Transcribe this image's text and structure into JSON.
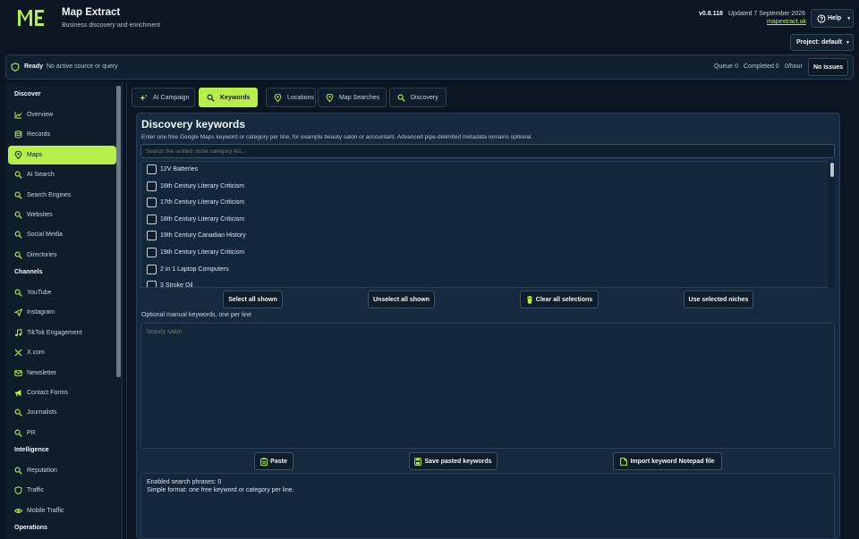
{
  "header": {
    "title": "Map Extract",
    "subtitle": "Business discovery and enrichment",
    "version": "v0.8.118",
    "updated": "Updated 7 September 2026",
    "site_link": "mapextract.uk",
    "help_label": "Help",
    "project_label": "Project: default",
    "accent_color": "#b7ef4a"
  },
  "status": {
    "state": "Ready",
    "message": "No active source or query",
    "queue": "Queue 0",
    "completed": "Completed 0",
    "rate": "0/hour",
    "issues": "No issues"
  },
  "sidebar": {
    "sections": [
      {
        "heading": "Discover",
        "items": [
          {
            "label": "Overview",
            "icon": "chart-line-icon"
          },
          {
            "label": "Records",
            "icon": "database-icon"
          },
          {
            "label": "Maps",
            "icon": "map-pin-icon",
            "active": true
          },
          {
            "label": "AI Search",
            "icon": "search-icon"
          },
          {
            "label": "Search Engines",
            "icon": "search-icon"
          },
          {
            "label": "Websites",
            "icon": "search-icon"
          },
          {
            "label": "Social Media",
            "icon": "search-icon"
          },
          {
            "label": "Directories",
            "icon": "search-icon"
          }
        ]
      },
      {
        "heading": "Channels",
        "items": [
          {
            "label": "YouTube",
            "icon": "search-icon"
          },
          {
            "label": "Instagram",
            "icon": "send-icon"
          },
          {
            "label": "TikTok Engagement",
            "icon": "music-note-icon"
          },
          {
            "label": "X.com",
            "icon": "x-logo-icon"
          },
          {
            "label": "Newsletter",
            "icon": "envelope-icon"
          },
          {
            "label": "Contact Forms",
            "icon": "megaphone-icon"
          },
          {
            "label": "Journalists",
            "icon": "search-icon"
          },
          {
            "label": "PR",
            "icon": "search-icon"
          }
        ]
      },
      {
        "heading": "Intelligence",
        "items": [
          {
            "label": "Reputation",
            "icon": "search-icon"
          },
          {
            "label": "Traffic",
            "icon": "shield-icon"
          },
          {
            "label": "Mobile Traffic",
            "icon": "eye-icon"
          }
        ]
      },
      {
        "heading": "Operations",
        "items": []
      }
    ]
  },
  "tabs": [
    {
      "label": "AI Campaign",
      "icon": "sparkle-icon"
    },
    {
      "label": "Keywords",
      "icon": "search-icon",
      "active": true
    },
    {
      "label": "Locations",
      "icon": "map-pin-icon"
    },
    {
      "label": "Map Searches",
      "icon": "map-pin-icon"
    },
    {
      "label": "Discovery",
      "icon": "search-icon"
    }
  ],
  "panel": {
    "title": "Discovery keywords",
    "description": "Enter one free Google Maps keyword or category per line, for example beauty salon or accountant. Advanced pipe-delimited metadata remains optional.",
    "search_placeholder": "Search the unified niche category list...",
    "niches": [
      "12V Batteries",
      "16th Century Literary Criticism",
      "17th Century Literary Criticism",
      "18th Century Literary Criticism",
      "19th Century Canadian History",
      "19th Century Literary Criticism",
      "2 in 1 Laptop Computers",
      "3 Stroke Oil"
    ],
    "niche_buttons": {
      "select_all": "Select all shown",
      "unselect_all": "Unselect all shown",
      "clear_all": "Clear all selections",
      "use_selected": "Use selected niches"
    },
    "manual_label": "Optional manual keywords, one per line",
    "manual_placeholder": "beauty salon",
    "keyword_buttons": {
      "paste": "Paste",
      "save": "Save pasted keywords",
      "import": "Import keyword Notepad file"
    },
    "output": {
      "enabled": "Enabled search phrases: 0",
      "format": "Simple format: one free keyword or category per line."
    }
  }
}
